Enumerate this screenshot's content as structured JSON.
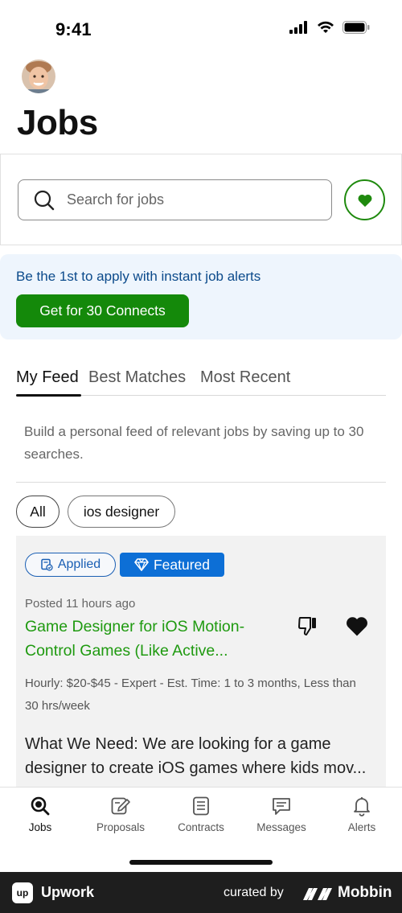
{
  "status_bar": {
    "time": "9:41"
  },
  "header": {
    "title": "Jobs"
  },
  "search": {
    "placeholder": "Search for jobs"
  },
  "promo": {
    "text": "Be the 1st to apply with instant job alerts",
    "button_label": "Get for 30 Connects"
  },
  "tabs": [
    {
      "label": "My Feed",
      "active": true
    },
    {
      "label": "Best Matches",
      "active": false
    },
    {
      "label": "Most Recent",
      "active": false
    }
  ],
  "feed_hint": "Build a personal feed of relevant jobs by saving up to 30 searches.",
  "chips": [
    {
      "label": "All",
      "selected": true
    },
    {
      "label": "ios designer",
      "selected": false
    }
  ],
  "job": {
    "badge_applied": "Applied",
    "badge_featured": "Featured",
    "posted": "Posted 11 hours ago",
    "title_line1": "Game Designer for iOS Motion-",
    "title_line2": "Control Games (Like Active...",
    "meta_line1": "Hourly: $20-$45 - Expert - Est. Time: 1 to 3 months, Less than",
    "meta_line2": "30 hrs/week",
    "desc_line1": "What We Need: We are looking for a game",
    "desc_line2": "designer to create iOS games where kids mov..."
  },
  "nav": [
    {
      "label": "Jobs",
      "icon": "search-icon",
      "active": true
    },
    {
      "label": "Proposals",
      "icon": "proposal-icon",
      "active": false
    },
    {
      "label": "Contracts",
      "icon": "contract-icon",
      "active": false
    },
    {
      "label": "Messages",
      "icon": "message-icon",
      "active": false
    },
    {
      "label": "Alerts",
      "icon": "bell-icon",
      "active": false
    }
  ],
  "footer": {
    "app_name": "Upwork",
    "logo_text": "up",
    "curated_by": "curated by",
    "brand": "Mobbin"
  },
  "colors": {
    "accent_green": "#14890a",
    "link_green": "#1f9a10",
    "featured_blue": "#0d6fd6",
    "promo_blue": "#0b4a8b"
  }
}
